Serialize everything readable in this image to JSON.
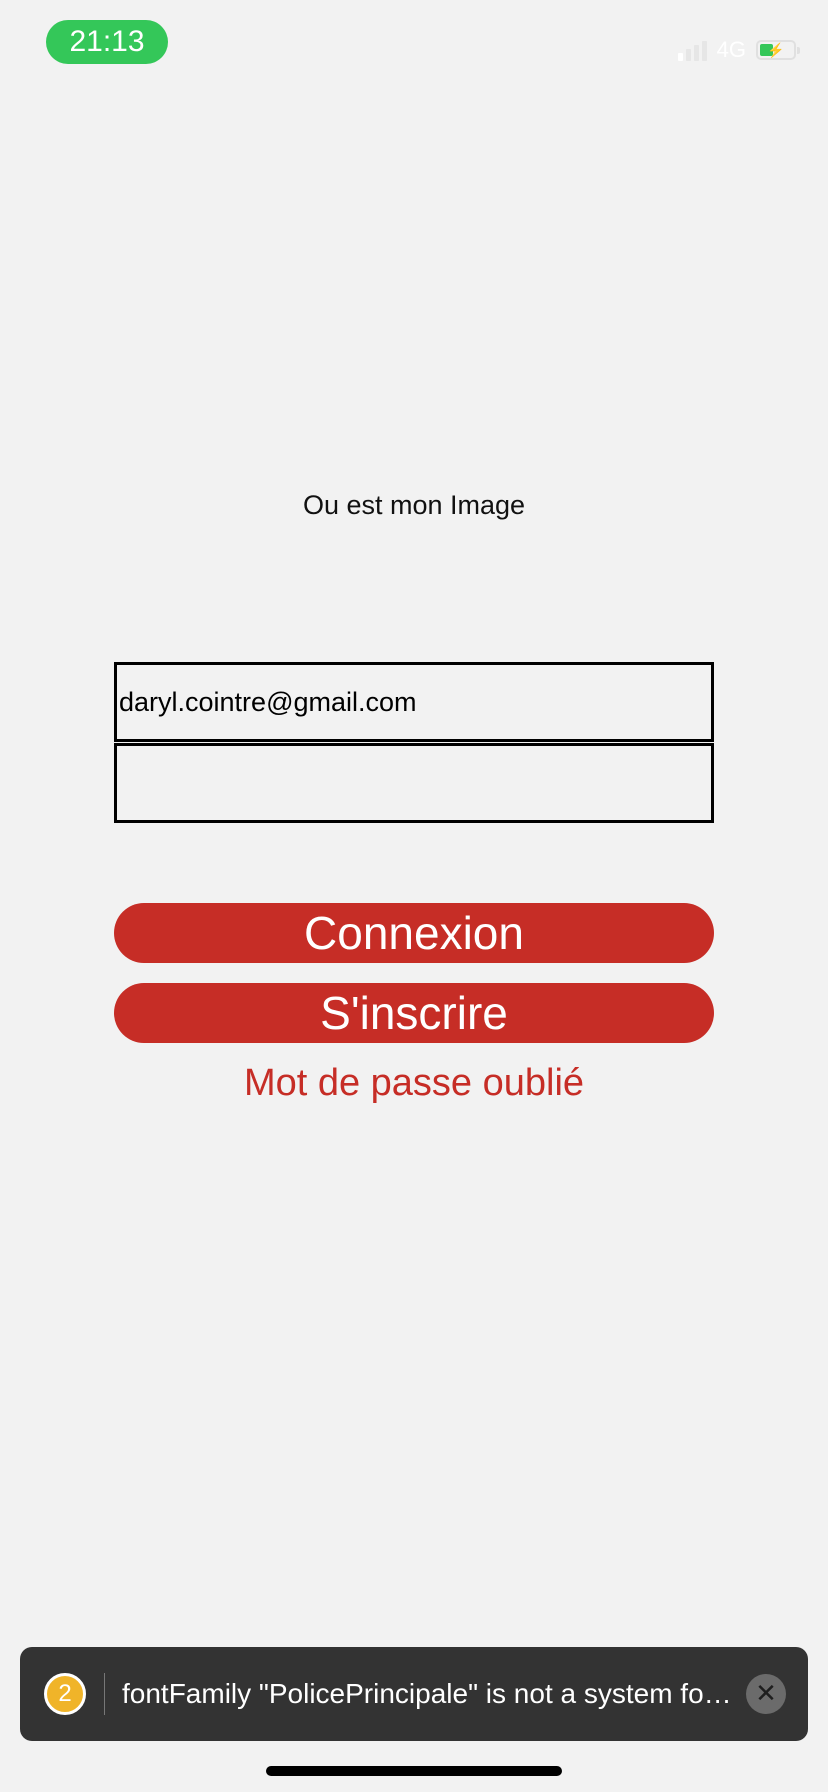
{
  "status_bar": {
    "time": "21:13",
    "network": "4G",
    "signal_icon": "cellular-signal-icon",
    "battery_icon": "battery-charging-icon",
    "battery_level": 0.4,
    "colors": {
      "time_pill": "#34c759",
      "battery_fill": "#34c759"
    }
  },
  "image_placeholder": {
    "alt_text": "Ou est mon Image"
  },
  "form": {
    "email_value": "daryl.cointre@gmail.com",
    "password_value": "",
    "login_label": "Connexion",
    "signup_label": "S'inscrire",
    "forgot_label": "Mot de passe oublié",
    "colors": {
      "accent": "#c62d26"
    }
  },
  "toast": {
    "count": "2",
    "message": "fontFamily \"PolicePrincipale\" is not a system font and has not been loaded through expo-font.",
    "close_icon": "close-icon",
    "colors": {
      "background": "#333333",
      "badge": "#f0b429"
    }
  }
}
